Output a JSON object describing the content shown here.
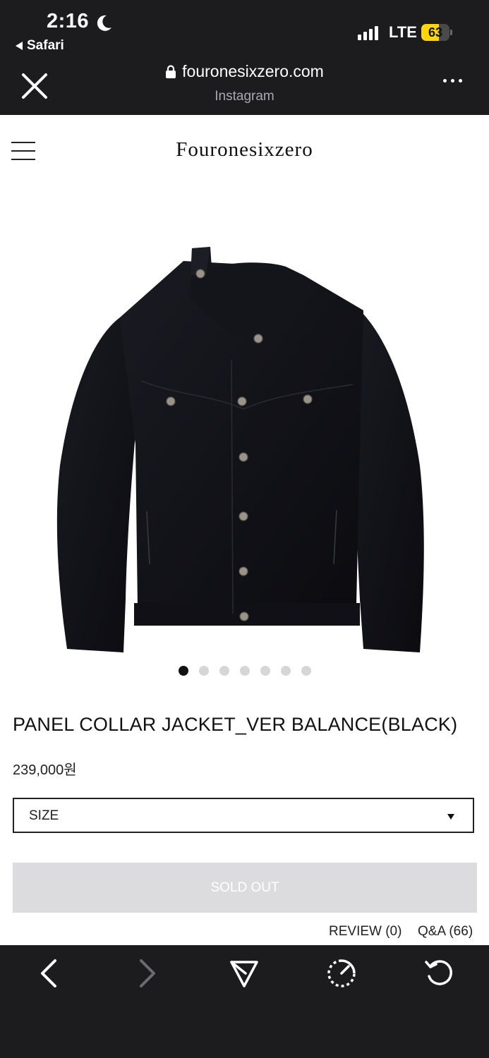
{
  "status_bar": {
    "time": "2:16",
    "back_app": "Safari",
    "network": "LTE",
    "battery_level": "63",
    "battery_fraction": 0.63,
    "signal_bars": 4
  },
  "browser": {
    "url": "fouronesixzero.com",
    "subtitle": "Instagram"
  },
  "site": {
    "brand": "Fouronesixzero"
  },
  "gallery": {
    "total_images": 7,
    "active_index": 0
  },
  "product": {
    "title": "PANEL COLLAR JACKET_VER BALANCE(BLACK)",
    "price": "239,000원",
    "size_select": {
      "selected": "SIZE"
    },
    "sold_out_label": "SOLD OUT",
    "review_label": "REVIEW (0)",
    "qa_label": "Q&A (66)"
  },
  "colors": {
    "chrome": "#1c1c1e",
    "battery": "#ffd60a",
    "soldout_bg": "#dcdcde"
  },
  "toolbar": {
    "icons": [
      "back-icon",
      "forward-icon",
      "share-icon",
      "speed-icon",
      "reload-icon"
    ]
  }
}
